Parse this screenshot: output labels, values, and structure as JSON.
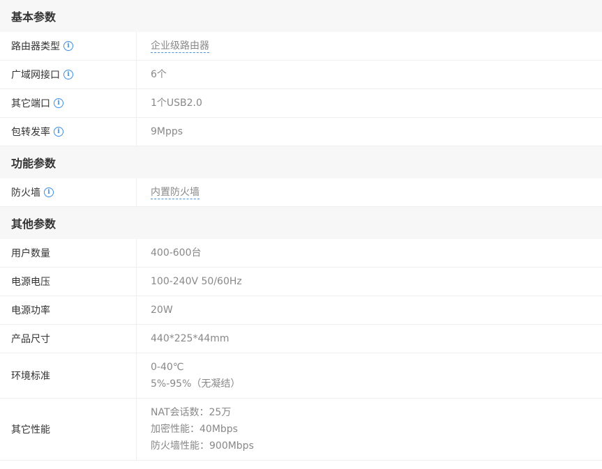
{
  "sections": [
    {
      "title": "基本参数",
      "rows": [
        {
          "label": "路由器类型",
          "value": "企业级路由器"
        },
        {
          "label": "广域网接口",
          "value": "6个"
        },
        {
          "label": "其它端口",
          "value": "1个USB2.0"
        },
        {
          "label": "包转发率",
          "value": "9Mpps"
        }
      ]
    },
    {
      "title": "功能参数",
      "rows": [
        {
          "label": "防火墙",
          "value": "内置防火墙"
        }
      ]
    },
    {
      "title": "其他参数",
      "rows": [
        {
          "label": "用户数量",
          "value": "400-600台"
        },
        {
          "label": "电源电压",
          "value": "100-240V 50/60Hz"
        },
        {
          "label": "电源功率",
          "value": "20W"
        },
        {
          "label": "产品尺寸",
          "value": "440*225*44mm"
        },
        {
          "label": "环境标准",
          "lines": [
            "0-40℃",
            "5%-95%（无凝结）"
          ]
        },
        {
          "label": "其它性能",
          "lines": [
            "NAT会话数：25万",
            "加密性能：40Mbps",
            "防火墙性能：900Mbps"
          ]
        }
      ]
    }
  ],
  "info_icon": {
    "glyph": "i",
    "name": "info-icon",
    "color": "#3a8ee6"
  }
}
